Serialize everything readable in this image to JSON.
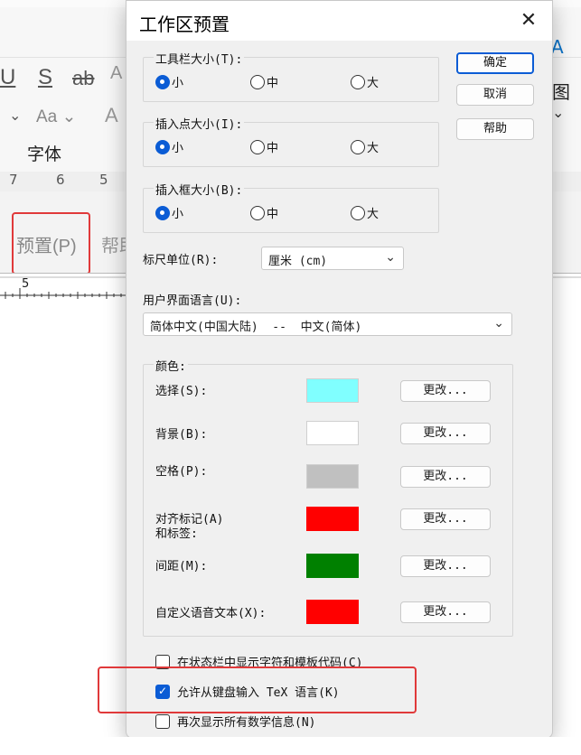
{
  "background": {
    "font_group_label": "字体",
    "tab_preferences": "预置(P)",
    "tab_help_partial": "帮助",
    "ruler_numbers": [
      "7",
      "6",
      "5"
    ],
    "ruler_mark": "5",
    "right_partial": "图"
  },
  "dialog": {
    "title": "工作区预置",
    "close": "✕",
    "buttons": {
      "ok": "确定",
      "cancel": "取消",
      "help": "帮助"
    },
    "toolbar_size": {
      "legend": "工具栏大小(T):",
      "options": [
        "小",
        "中",
        "大"
      ],
      "selected": "小"
    },
    "insertion_point_size": {
      "legend": "插入点大小(I):",
      "options": [
        "小",
        "中",
        "大"
      ],
      "selected": "小"
    },
    "insertion_box_size": {
      "legend": "插入框大小(B):",
      "options": [
        "小",
        "中",
        "大"
      ],
      "selected": "小"
    },
    "ruler_units": {
      "label": "标尺单位(R):",
      "value": "厘米 (cm)"
    },
    "ui_language": {
      "label": "用户界面语言(U):",
      "value": "简体中文(中国大陆)  --  中文(简体)"
    },
    "colors": {
      "legend": "颜色:",
      "change_label": "更改...",
      "items": [
        {
          "label": "选择(S):",
          "color": "#80ffff"
        },
        {
          "label": "背景(B):",
          "color": "#ffffff"
        },
        {
          "label": "空格(P):",
          "color": "#c0c0c0"
        },
        {
          "label": "对齐标记(A)",
          "label2": "和标签:",
          "color": "#ff0000"
        },
        {
          "label": "间距(M):",
          "color": "#008000"
        },
        {
          "label": "自定义语音文本(X):",
          "color": "#ff0000"
        }
      ]
    },
    "checkboxes": [
      {
        "label": "在状态栏中显示字符和模板代码(C)",
        "checked": false
      },
      {
        "label": "允许从键盘输入 TeX 语言(K)",
        "checked": true
      },
      {
        "label": "再次显示所有数学信息(N)",
        "checked": false
      }
    ],
    "accent_color": "#0b5cd5",
    "highlight_color": "#e0393a"
  }
}
